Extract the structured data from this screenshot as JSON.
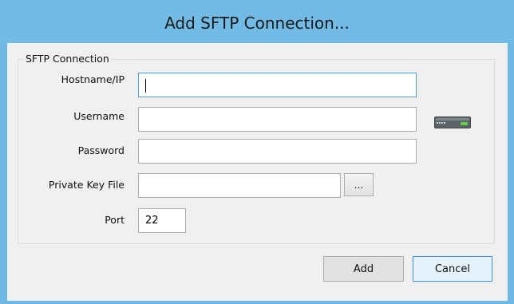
{
  "window": {
    "title": "Add SFTP Connection..."
  },
  "group": {
    "legend": "SFTP Connection"
  },
  "fields": {
    "hostname": {
      "label": "Hostname/IP",
      "value": ""
    },
    "username": {
      "label": "Username",
      "value": ""
    },
    "password": {
      "label": "Password",
      "value": ""
    },
    "private_key": {
      "label": "Private Key File",
      "value": "",
      "browse_label": "..."
    },
    "port": {
      "label": "Port",
      "value": "22"
    }
  },
  "icons": {
    "server": "server-icon"
  },
  "buttons": {
    "add": "Add",
    "cancel": "Cancel"
  },
  "colors": {
    "title_bar": "#72bbe6",
    "client_bg": "#f0f0f0",
    "focus_border": "#4f9ddb",
    "default_button_border": "#3c91d6"
  }
}
